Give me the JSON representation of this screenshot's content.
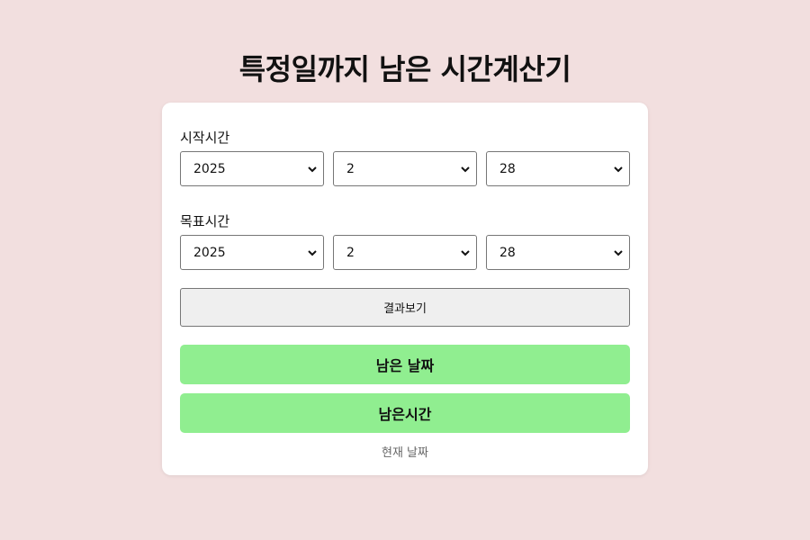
{
  "page": {
    "title": "특정일까지 남은 시간계산기"
  },
  "start": {
    "label": "시작시간",
    "year": "2025",
    "month": "2",
    "day": "28"
  },
  "target": {
    "label": "목표시간",
    "year": "2025",
    "month": "2",
    "day": "28"
  },
  "buttons": {
    "result": "결과보기",
    "remaining_days": "남은 날짜",
    "remaining_time": "남은시간"
  },
  "current_date_label": "현재 날짜",
  "colors": {
    "background": "#f2dfdf",
    "card": "#ffffff",
    "green": "#90ee90",
    "button_gray": "#efefef"
  },
  "icons": {
    "dropdown": "chevron-down-icon"
  }
}
